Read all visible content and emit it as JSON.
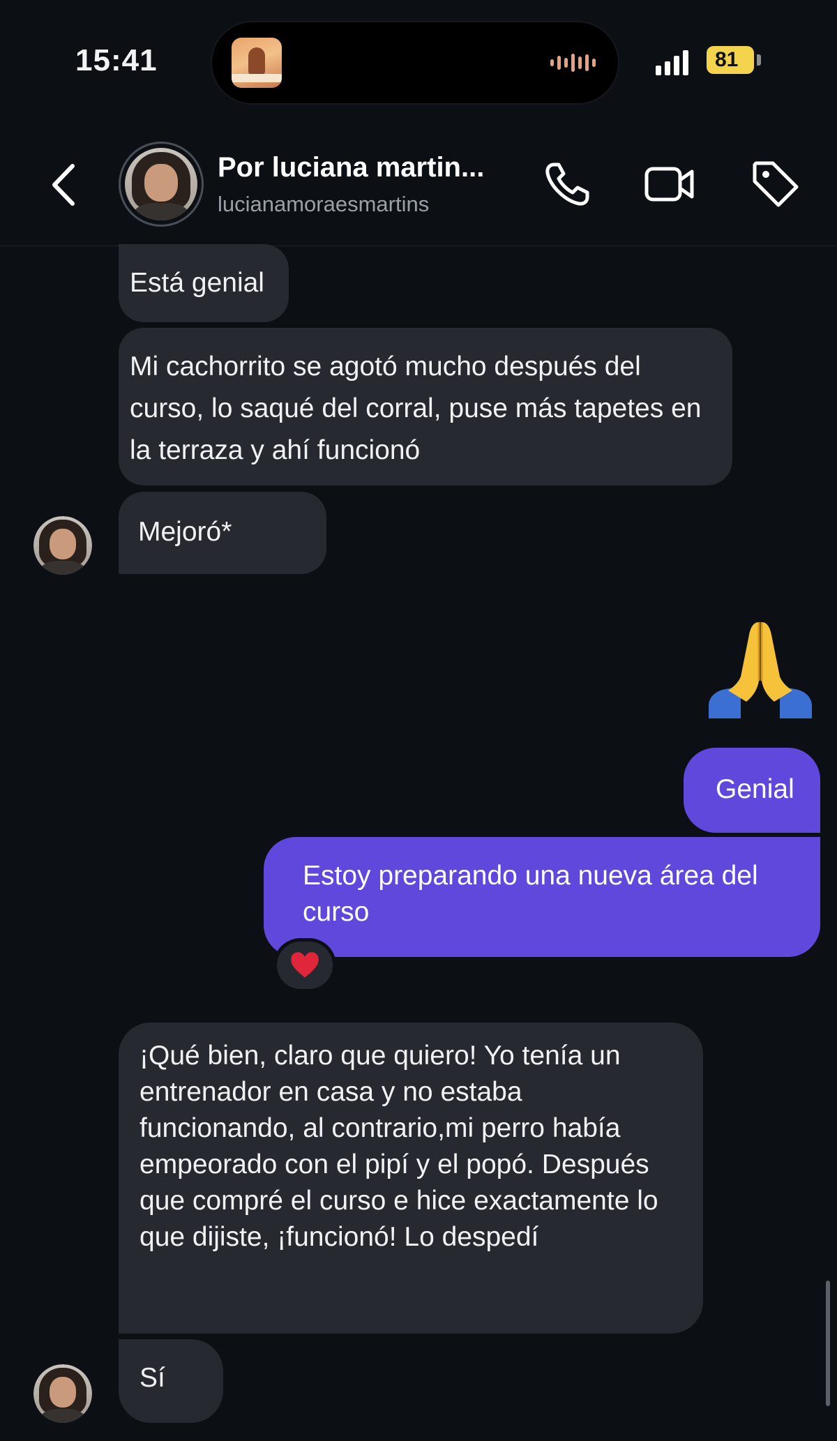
{
  "status_bar": {
    "time": "15:41",
    "battery": "81",
    "icons": [
      "signal-icon",
      "battery-charging-icon",
      "waveform-icon"
    ]
  },
  "header": {
    "contact_name": "Por luciana martin...",
    "contact_handle": "lucianamoraesmartins",
    "icons": [
      "back-chevron-icon",
      "phone-icon",
      "video-camera-icon",
      "tag-icon"
    ]
  },
  "messages": [
    {
      "from": "them",
      "text": "Está genial"
    },
    {
      "from": "them",
      "text": "Mi cachorrito se agotó mucho después del curso, lo saqué del corral, puse más tapetes en la terraza y ahí funcionó"
    },
    {
      "from": "them",
      "text": "Mejoró*"
    },
    {
      "from": "me",
      "emoji": "🙏"
    },
    {
      "from": "me",
      "text": "Genial"
    },
    {
      "from": "me",
      "text": "Estoy preparando una nueva área del curso",
      "reaction": "❤️"
    },
    {
      "from": "them",
      "text": "¡Qué bien, claro que quiero! Yo tenía un entrenador en casa y no estaba funcionando, al contrario,mi perro había empeorado con el pipí y el popó. Después que compré el curso e hice exactamente lo que dijiste, ¡funcionó! Lo despedí"
    },
    {
      "from": "them",
      "text": "Sí"
    }
  ],
  "colors": {
    "background": "#0c0f14",
    "incoming_bubble": "#262930",
    "outgoing_bubble": "#6148dd",
    "battery": "#f4d44c"
  }
}
